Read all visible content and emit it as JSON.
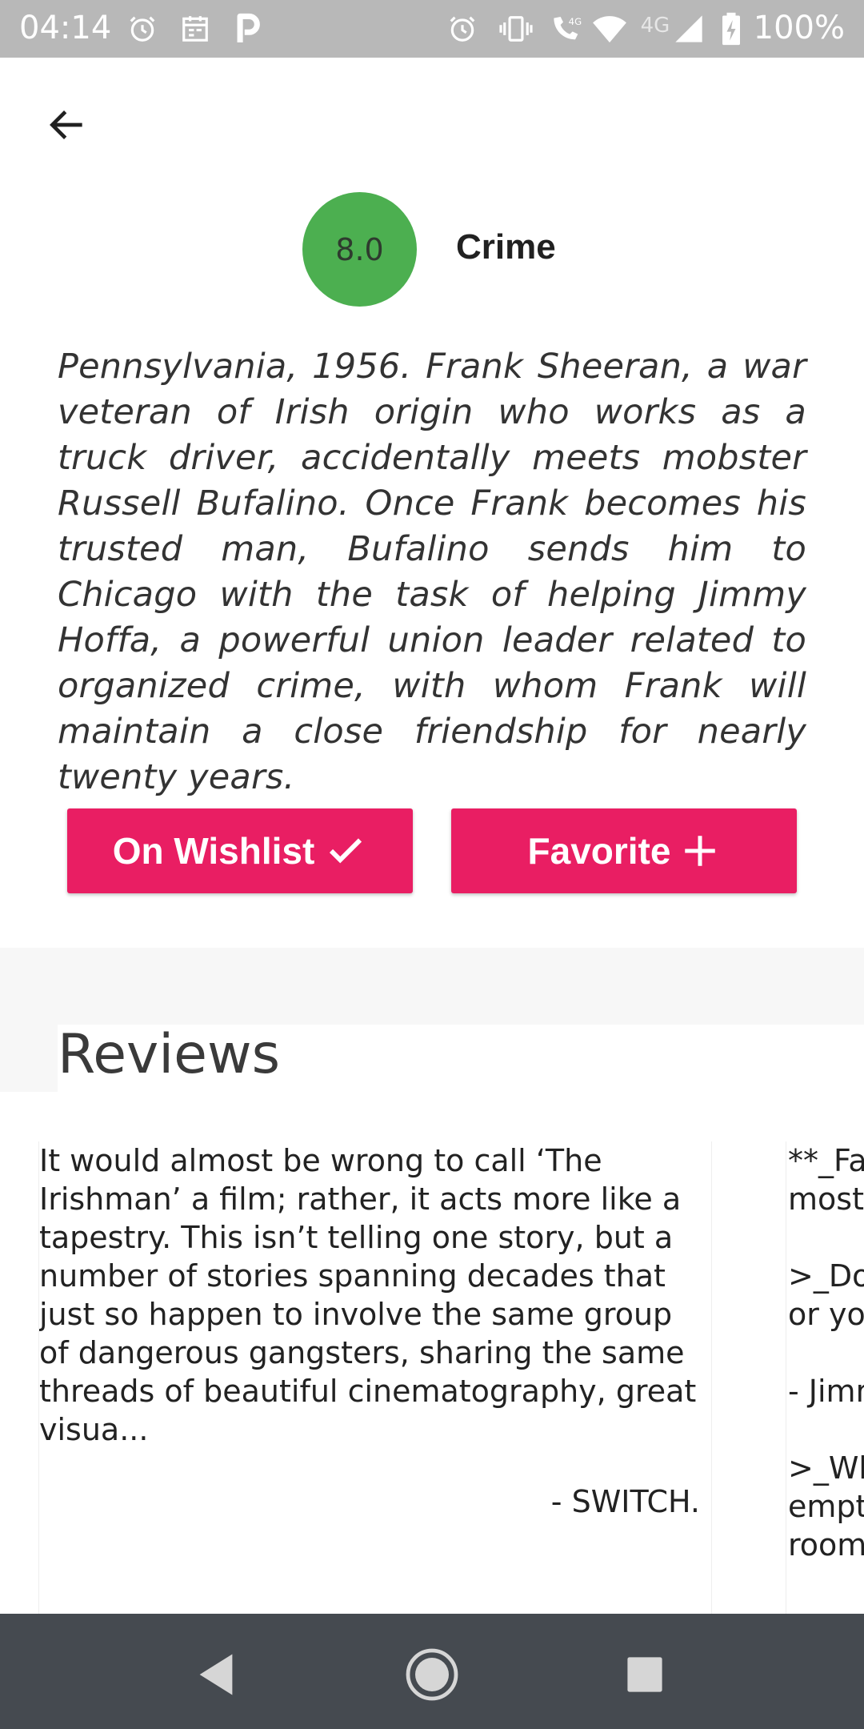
{
  "status_bar": {
    "time": "04:14",
    "battery": "100%",
    "network_label": "4G",
    "left_icons": [
      "alarm-icon",
      "calendar-icon",
      "parking-icon"
    ],
    "right_icons": [
      "alarm-icon",
      "vibrate-icon",
      "wifi-call-icon",
      "wifi-icon",
      "signal-icon",
      "battery-charging-icon"
    ]
  },
  "movie": {
    "rating": "8.0",
    "genre": "Crime",
    "overview": "Pennsylvania, 1956. Frank Sheeran, a war veteran of Irish origin who works as a truck driver, accidentally meets mobster Russell Bufalino. Once Frank becomes his trusted man, Bufalino sends him to Chicago with the task of helping Jimmy Hoffa, a powerful union leader related to organized crime, with whom Frank will maintain a close friendship for nearly twenty years."
  },
  "actions": {
    "wishlist_label": "On Wishlist",
    "favorite_label": "Favorite"
  },
  "reviews": {
    "title": "Reviews",
    "items": [
      {
        "text": "It would almost be wrong to call ‘The Irishman’ a film; rather, it acts more like a tapestry. This isn’t telling one story, but a number of stories spanning decades that just so happen to involve the same group of dangerous gangsters, sharing the same threads of beautiful cinematography, great visua...",
        "author": "- SWITCH."
      },
      {
        "text": "**_Fa\nmost\n\n>_Do\nor yo\n\n- Jimm\n\n>_Wh\nempt\nroom"
      }
    ]
  },
  "colors": {
    "accent": "#e91e63",
    "rating_circle": "#4caf50",
    "status_bar": "#b8b8b8",
    "nav_bar": "#454a50"
  }
}
